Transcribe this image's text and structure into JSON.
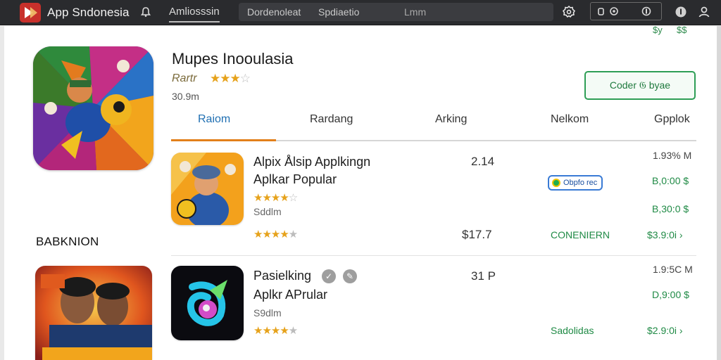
{
  "topbar": {
    "app_title": "App Sndonesia",
    "active_tab": "Amliosssin",
    "tabs": [
      "Dordenoleat",
      "Spdiaetio",
      "Lmm"
    ]
  },
  "hero": {
    "title": "Mupes Inooulasia",
    "rating_label": "Rartr",
    "stars_filled": "★★★",
    "stars_empty": "☆",
    "size": "30.9m",
    "button_label": "Coder 𝔊 byae",
    "corner_marks": [
      "$y",
      "$$"
    ]
  },
  "tabs": [
    {
      "label": "Raiom",
      "active": true
    },
    {
      "label": "Rardang",
      "active": false
    },
    {
      "label": "Arking",
      "active": false
    },
    {
      "label": "Nelkom",
      "active": false
    },
    {
      "label": "Gpplok",
      "active": false
    }
  ],
  "section_label": "BABKNION",
  "rows": [
    {
      "name": "Alpix Ålsip Applkingn",
      "subtitle": "Aplkar Popular",
      "developer": "Sddlm",
      "stars_filled": "★★★★",
      "stars_empty": "☆",
      "stars2_filled": "★★★★",
      "stars2_empty": "★",
      "count": "2.14",
      "price": "$17.7",
      "size": "1.93% M",
      "chip": "Obpfo rec",
      "prices": [
        "B,0:00 $",
        "B,30:0 $"
      ],
      "status": "CONENIERN",
      "status_price": "$3.9:0i ›"
    },
    {
      "name": "Pasielking",
      "subtitle": "Aplkr APrular",
      "developer": "S9dlm",
      "stars_filled": "★★★★",
      "stars_empty": "★",
      "count": "31 P",
      "size": "1.9:5C M",
      "prices": [
        "D,9:00 $"
      ],
      "status": "Sadolidas",
      "status_price": "$2.9:0i ›"
    }
  ],
  "colors": {
    "topbar": "#2a2b2e",
    "accent_blue": "#1f6fb2",
    "tab_underline": "#e2801b",
    "green": "#1f8a45",
    "star": "#e6a21b"
  }
}
